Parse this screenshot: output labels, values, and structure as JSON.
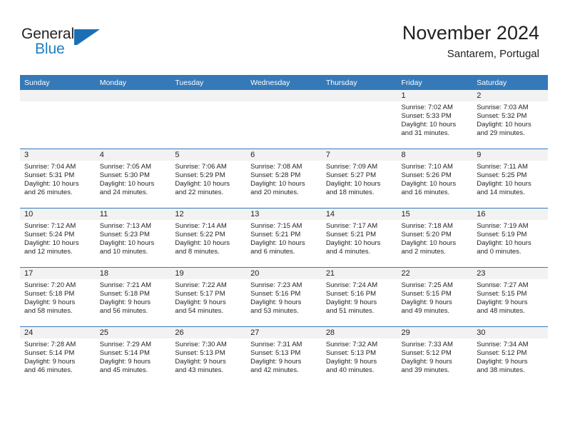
{
  "brand": {
    "name_part1": "General",
    "name_part2": "Blue",
    "accent_color": "#1c6fb5",
    "logo_icon": "flag-triangle-icon"
  },
  "header": {
    "title": "November 2024",
    "location": "Santarem, Portugal"
  },
  "calendar": {
    "header_bg": "#3579b8",
    "daynum_bg": "#f2f2f2",
    "weekday_headers": [
      "Sunday",
      "Monday",
      "Tuesday",
      "Wednesday",
      "Thursday",
      "Friday",
      "Saturday"
    ],
    "weeks": [
      [
        {
          "day": "",
          "sunrise": "",
          "sunset": "",
          "daylight1": "",
          "daylight2": ""
        },
        {
          "day": "",
          "sunrise": "",
          "sunset": "",
          "daylight1": "",
          "daylight2": ""
        },
        {
          "day": "",
          "sunrise": "",
          "sunset": "",
          "daylight1": "",
          "daylight2": ""
        },
        {
          "day": "",
          "sunrise": "",
          "sunset": "",
          "daylight1": "",
          "daylight2": ""
        },
        {
          "day": "",
          "sunrise": "",
          "sunset": "",
          "daylight1": "",
          "daylight2": ""
        },
        {
          "day": "1",
          "sunrise": "Sunrise: 7:02 AM",
          "sunset": "Sunset: 5:33 PM",
          "daylight1": "Daylight: 10 hours",
          "daylight2": "and 31 minutes."
        },
        {
          "day": "2",
          "sunrise": "Sunrise: 7:03 AM",
          "sunset": "Sunset: 5:32 PM",
          "daylight1": "Daylight: 10 hours",
          "daylight2": "and 29 minutes."
        }
      ],
      [
        {
          "day": "3",
          "sunrise": "Sunrise: 7:04 AM",
          "sunset": "Sunset: 5:31 PM",
          "daylight1": "Daylight: 10 hours",
          "daylight2": "and 26 minutes."
        },
        {
          "day": "4",
          "sunrise": "Sunrise: 7:05 AM",
          "sunset": "Sunset: 5:30 PM",
          "daylight1": "Daylight: 10 hours",
          "daylight2": "and 24 minutes."
        },
        {
          "day": "5",
          "sunrise": "Sunrise: 7:06 AM",
          "sunset": "Sunset: 5:29 PM",
          "daylight1": "Daylight: 10 hours",
          "daylight2": "and 22 minutes."
        },
        {
          "day": "6",
          "sunrise": "Sunrise: 7:08 AM",
          "sunset": "Sunset: 5:28 PM",
          "daylight1": "Daylight: 10 hours",
          "daylight2": "and 20 minutes."
        },
        {
          "day": "7",
          "sunrise": "Sunrise: 7:09 AM",
          "sunset": "Sunset: 5:27 PM",
          "daylight1": "Daylight: 10 hours",
          "daylight2": "and 18 minutes."
        },
        {
          "day": "8",
          "sunrise": "Sunrise: 7:10 AM",
          "sunset": "Sunset: 5:26 PM",
          "daylight1": "Daylight: 10 hours",
          "daylight2": "and 16 minutes."
        },
        {
          "day": "9",
          "sunrise": "Sunrise: 7:11 AM",
          "sunset": "Sunset: 5:25 PM",
          "daylight1": "Daylight: 10 hours",
          "daylight2": "and 14 minutes."
        }
      ],
      [
        {
          "day": "10",
          "sunrise": "Sunrise: 7:12 AM",
          "sunset": "Sunset: 5:24 PM",
          "daylight1": "Daylight: 10 hours",
          "daylight2": "and 12 minutes."
        },
        {
          "day": "11",
          "sunrise": "Sunrise: 7:13 AM",
          "sunset": "Sunset: 5:23 PM",
          "daylight1": "Daylight: 10 hours",
          "daylight2": "and 10 minutes."
        },
        {
          "day": "12",
          "sunrise": "Sunrise: 7:14 AM",
          "sunset": "Sunset: 5:22 PM",
          "daylight1": "Daylight: 10 hours",
          "daylight2": "and 8 minutes."
        },
        {
          "day": "13",
          "sunrise": "Sunrise: 7:15 AM",
          "sunset": "Sunset: 5:21 PM",
          "daylight1": "Daylight: 10 hours",
          "daylight2": "and 6 minutes."
        },
        {
          "day": "14",
          "sunrise": "Sunrise: 7:17 AM",
          "sunset": "Sunset: 5:21 PM",
          "daylight1": "Daylight: 10 hours",
          "daylight2": "and 4 minutes."
        },
        {
          "day": "15",
          "sunrise": "Sunrise: 7:18 AM",
          "sunset": "Sunset: 5:20 PM",
          "daylight1": "Daylight: 10 hours",
          "daylight2": "and 2 minutes."
        },
        {
          "day": "16",
          "sunrise": "Sunrise: 7:19 AM",
          "sunset": "Sunset: 5:19 PM",
          "daylight1": "Daylight: 10 hours",
          "daylight2": "and 0 minutes."
        }
      ],
      [
        {
          "day": "17",
          "sunrise": "Sunrise: 7:20 AM",
          "sunset": "Sunset: 5:18 PM",
          "daylight1": "Daylight: 9 hours",
          "daylight2": "and 58 minutes."
        },
        {
          "day": "18",
          "sunrise": "Sunrise: 7:21 AM",
          "sunset": "Sunset: 5:18 PM",
          "daylight1": "Daylight: 9 hours",
          "daylight2": "and 56 minutes."
        },
        {
          "day": "19",
          "sunrise": "Sunrise: 7:22 AM",
          "sunset": "Sunset: 5:17 PM",
          "daylight1": "Daylight: 9 hours",
          "daylight2": "and 54 minutes."
        },
        {
          "day": "20",
          "sunrise": "Sunrise: 7:23 AM",
          "sunset": "Sunset: 5:16 PM",
          "daylight1": "Daylight: 9 hours",
          "daylight2": "and 53 minutes."
        },
        {
          "day": "21",
          "sunrise": "Sunrise: 7:24 AM",
          "sunset": "Sunset: 5:16 PM",
          "daylight1": "Daylight: 9 hours",
          "daylight2": "and 51 minutes."
        },
        {
          "day": "22",
          "sunrise": "Sunrise: 7:25 AM",
          "sunset": "Sunset: 5:15 PM",
          "daylight1": "Daylight: 9 hours",
          "daylight2": "and 49 minutes."
        },
        {
          "day": "23",
          "sunrise": "Sunrise: 7:27 AM",
          "sunset": "Sunset: 5:15 PM",
          "daylight1": "Daylight: 9 hours",
          "daylight2": "and 48 minutes."
        }
      ],
      [
        {
          "day": "24",
          "sunrise": "Sunrise: 7:28 AM",
          "sunset": "Sunset: 5:14 PM",
          "daylight1": "Daylight: 9 hours",
          "daylight2": "and 46 minutes."
        },
        {
          "day": "25",
          "sunrise": "Sunrise: 7:29 AM",
          "sunset": "Sunset: 5:14 PM",
          "daylight1": "Daylight: 9 hours",
          "daylight2": "and 45 minutes."
        },
        {
          "day": "26",
          "sunrise": "Sunrise: 7:30 AM",
          "sunset": "Sunset: 5:13 PM",
          "daylight1": "Daylight: 9 hours",
          "daylight2": "and 43 minutes."
        },
        {
          "day": "27",
          "sunrise": "Sunrise: 7:31 AM",
          "sunset": "Sunset: 5:13 PM",
          "daylight1": "Daylight: 9 hours",
          "daylight2": "and 42 minutes."
        },
        {
          "day": "28",
          "sunrise": "Sunrise: 7:32 AM",
          "sunset": "Sunset: 5:13 PM",
          "daylight1": "Daylight: 9 hours",
          "daylight2": "and 40 minutes."
        },
        {
          "day": "29",
          "sunrise": "Sunrise: 7:33 AM",
          "sunset": "Sunset: 5:12 PM",
          "daylight1": "Daylight: 9 hours",
          "daylight2": "and 39 minutes."
        },
        {
          "day": "30",
          "sunrise": "Sunrise: 7:34 AM",
          "sunset": "Sunset: 5:12 PM",
          "daylight1": "Daylight: 9 hours",
          "daylight2": "and 38 minutes."
        }
      ]
    ]
  }
}
